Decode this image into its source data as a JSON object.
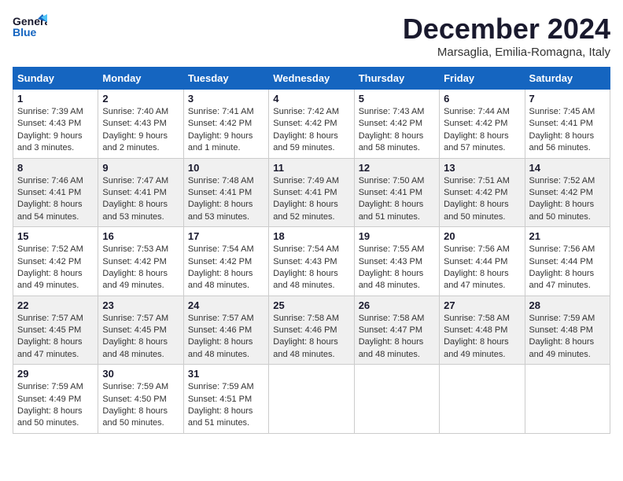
{
  "header": {
    "logo_line1": "General",
    "logo_line2": "Blue",
    "month": "December 2024",
    "location": "Marsaglia, Emilia-Romagna, Italy"
  },
  "days_of_week": [
    "Sunday",
    "Monday",
    "Tuesday",
    "Wednesday",
    "Thursday",
    "Friday",
    "Saturday"
  ],
  "weeks": [
    [
      {
        "day": "1",
        "sunrise": "7:39 AM",
        "sunset": "4:43 PM",
        "daylight": "9 hours and 3 minutes."
      },
      {
        "day": "2",
        "sunrise": "7:40 AM",
        "sunset": "4:43 PM",
        "daylight": "9 hours and 2 minutes."
      },
      {
        "day": "3",
        "sunrise": "7:41 AM",
        "sunset": "4:42 PM",
        "daylight": "9 hours and 1 minute."
      },
      {
        "day": "4",
        "sunrise": "7:42 AM",
        "sunset": "4:42 PM",
        "daylight": "8 hours and 59 minutes."
      },
      {
        "day": "5",
        "sunrise": "7:43 AM",
        "sunset": "4:42 PM",
        "daylight": "8 hours and 58 minutes."
      },
      {
        "day": "6",
        "sunrise": "7:44 AM",
        "sunset": "4:42 PM",
        "daylight": "8 hours and 57 minutes."
      },
      {
        "day": "7",
        "sunrise": "7:45 AM",
        "sunset": "4:41 PM",
        "daylight": "8 hours and 56 minutes."
      }
    ],
    [
      {
        "day": "8",
        "sunrise": "7:46 AM",
        "sunset": "4:41 PM",
        "daylight": "8 hours and 54 minutes."
      },
      {
        "day": "9",
        "sunrise": "7:47 AM",
        "sunset": "4:41 PM",
        "daylight": "8 hours and 53 minutes."
      },
      {
        "day": "10",
        "sunrise": "7:48 AM",
        "sunset": "4:41 PM",
        "daylight": "8 hours and 53 minutes."
      },
      {
        "day": "11",
        "sunrise": "7:49 AM",
        "sunset": "4:41 PM",
        "daylight": "8 hours and 52 minutes."
      },
      {
        "day": "12",
        "sunrise": "7:50 AM",
        "sunset": "4:41 PM",
        "daylight": "8 hours and 51 minutes."
      },
      {
        "day": "13",
        "sunrise": "7:51 AM",
        "sunset": "4:42 PM",
        "daylight": "8 hours and 50 minutes."
      },
      {
        "day": "14",
        "sunrise": "7:52 AM",
        "sunset": "4:42 PM",
        "daylight": "8 hours and 50 minutes."
      }
    ],
    [
      {
        "day": "15",
        "sunrise": "7:52 AM",
        "sunset": "4:42 PM",
        "daylight": "8 hours and 49 minutes."
      },
      {
        "day": "16",
        "sunrise": "7:53 AM",
        "sunset": "4:42 PM",
        "daylight": "8 hours and 49 minutes."
      },
      {
        "day": "17",
        "sunrise": "7:54 AM",
        "sunset": "4:42 PM",
        "daylight": "8 hours and 48 minutes."
      },
      {
        "day": "18",
        "sunrise": "7:54 AM",
        "sunset": "4:43 PM",
        "daylight": "8 hours and 48 minutes."
      },
      {
        "day": "19",
        "sunrise": "7:55 AM",
        "sunset": "4:43 PM",
        "daylight": "8 hours and 48 minutes."
      },
      {
        "day": "20",
        "sunrise": "7:56 AM",
        "sunset": "4:44 PM",
        "daylight": "8 hours and 47 minutes."
      },
      {
        "day": "21",
        "sunrise": "7:56 AM",
        "sunset": "4:44 PM",
        "daylight": "8 hours and 47 minutes."
      }
    ],
    [
      {
        "day": "22",
        "sunrise": "7:57 AM",
        "sunset": "4:45 PM",
        "daylight": "8 hours and 47 minutes."
      },
      {
        "day": "23",
        "sunrise": "7:57 AM",
        "sunset": "4:45 PM",
        "daylight": "8 hours and 48 minutes."
      },
      {
        "day": "24",
        "sunrise": "7:57 AM",
        "sunset": "4:46 PM",
        "daylight": "8 hours and 48 minutes."
      },
      {
        "day": "25",
        "sunrise": "7:58 AM",
        "sunset": "4:46 PM",
        "daylight": "8 hours and 48 minutes."
      },
      {
        "day": "26",
        "sunrise": "7:58 AM",
        "sunset": "4:47 PM",
        "daylight": "8 hours and 48 minutes."
      },
      {
        "day": "27",
        "sunrise": "7:58 AM",
        "sunset": "4:48 PM",
        "daylight": "8 hours and 49 minutes."
      },
      {
        "day": "28",
        "sunrise": "7:59 AM",
        "sunset": "4:48 PM",
        "daylight": "8 hours and 49 minutes."
      }
    ],
    [
      {
        "day": "29",
        "sunrise": "7:59 AM",
        "sunset": "4:49 PM",
        "daylight": "8 hours and 50 minutes."
      },
      {
        "day": "30",
        "sunrise": "7:59 AM",
        "sunset": "4:50 PM",
        "daylight": "8 hours and 50 minutes."
      },
      {
        "day": "31",
        "sunrise": "7:59 AM",
        "sunset": "4:51 PM",
        "daylight": "8 hours and 51 minutes."
      },
      null,
      null,
      null,
      null
    ]
  ]
}
